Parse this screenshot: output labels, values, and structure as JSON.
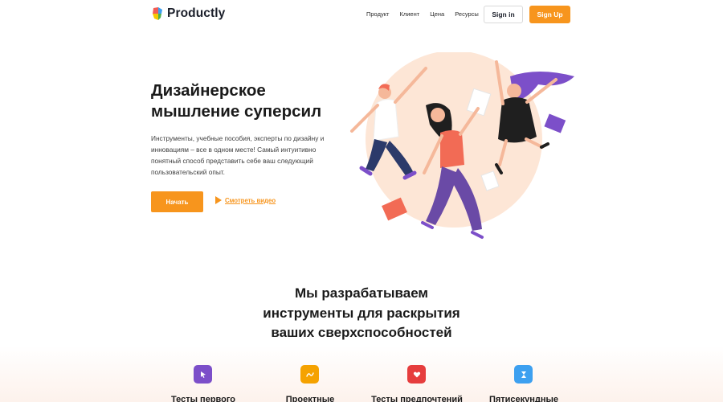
{
  "header": {
    "logo_text": "Productly",
    "nav": [
      "Продукт",
      "Клиент",
      "Цена",
      "Ресурсы"
    ],
    "signin_label": "Sign in",
    "signup_label": "Sign Up"
  },
  "hero": {
    "title_line1": "Дизайнерское",
    "title_line2": "мышление суперсил",
    "subtitle": "Инструменты, учебные пособия, эксперты по дизайну и инновациям – все в одном месте! Самый интуитивно понятный способ представить себе ваш следующий пользовательский опыт.",
    "start_label": "Начать",
    "video_label": "Смотреть видео"
  },
  "features_section": {
    "title_line1": "Мы разрабатываем",
    "title_line2": "инструменты для раскрытия",
    "title_line3": "ваших сверхспособностей",
    "items": [
      {
        "label": "Тесты первого",
        "color": "#7c4fc9",
        "icon": "cursor-icon"
      },
      {
        "label": "Проектные",
        "color": "#f5a200",
        "icon": "pen-icon"
      },
      {
        "label": "Тесты предпочтений",
        "color": "#e63d3d",
        "icon": "heart-icon"
      },
      {
        "label": "Пятисекундные",
        "color": "#3da0f0",
        "icon": "hourglass-icon"
      }
    ]
  },
  "colors": {
    "accent": "#f7951d",
    "purple": "#7c4fc9",
    "peach": "#fde6d6"
  }
}
